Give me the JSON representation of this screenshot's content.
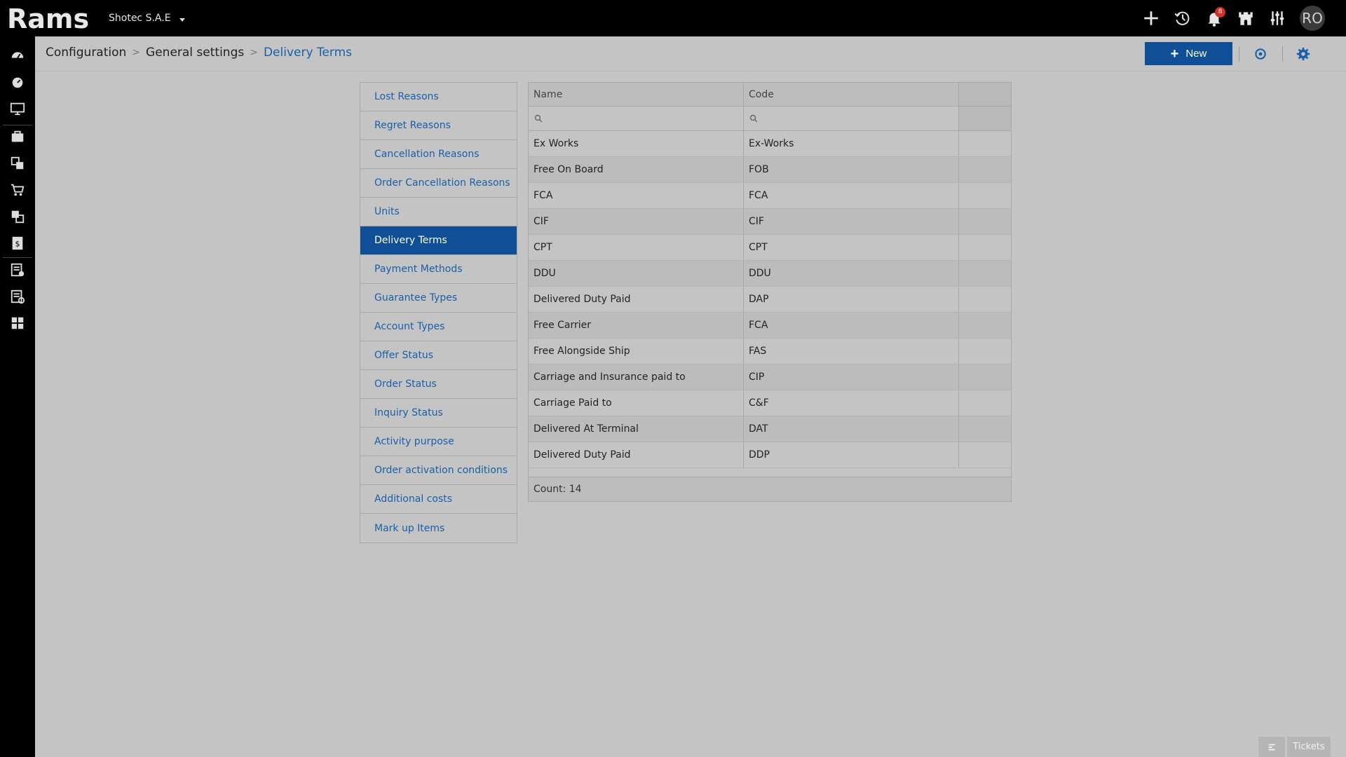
{
  "app": {
    "logo_text": "Rams",
    "company": "Shotec S.A.E",
    "notifications_count": "8",
    "user_initials": "RO"
  },
  "colors": {
    "primary": "#0f4f97",
    "link": "#1a5fa8",
    "topbar": "#000000",
    "badge": "#d32f2f"
  },
  "icons": {
    "topbar": [
      "plus-icon",
      "history-icon",
      "bell-icon",
      "castle-icon",
      "sliders-icon"
    ],
    "rail": [
      "dashboard-icon",
      "gauge-icon",
      "monitor-icon",
      "briefcase-icon",
      "documents-icon",
      "cart-icon",
      "reports-icon",
      "invoice-icon",
      "checklist-icon",
      "settings-list-icon",
      "grid-layout-icon"
    ]
  },
  "breadcrumb": {
    "items": [
      "Configuration",
      "General settings"
    ],
    "current": "Delivery Terms"
  },
  "toolbar": {
    "new_label": "New"
  },
  "settings_menu": {
    "items": [
      "Lost Reasons",
      "Regret Reasons",
      "Cancellation Reasons",
      "Order Cancellation Reasons",
      "Units",
      "Delivery Terms",
      "Payment Methods",
      "Guarantee Types",
      "Account Types",
      "Offer Status",
      "Order Status",
      "Inquiry Status",
      "Activity purpose",
      "Order activation conditions",
      "Additional costs",
      "Mark up Items"
    ],
    "active_index": 5
  },
  "grid": {
    "columns": [
      "Name",
      "Code"
    ],
    "rows": [
      [
        "Ex Works",
        "Ex-Works"
      ],
      [
        "Free On Board",
        "FOB"
      ],
      [
        "FCA",
        "FCA"
      ],
      [
        "CIF",
        "CIF"
      ],
      [
        "CPT",
        "CPT"
      ],
      [
        "DDU",
        "DDU"
      ],
      [
        "Delivered Duty Paid",
        "DAP"
      ],
      [
        "Free Carrier",
        "FCA"
      ],
      [
        "Free Alongside Ship",
        "FAS"
      ],
      [
        "Carriage and Insurance paid to",
        "CIP"
      ],
      [
        "Carriage Paid to",
        "C&F"
      ],
      [
        "Delivered At Terminal",
        "DAT"
      ],
      [
        "Delivered Duty Paid",
        "DDP"
      ]
    ],
    "footer": "Count: 14"
  },
  "tickets": {
    "label": "Tickets"
  }
}
